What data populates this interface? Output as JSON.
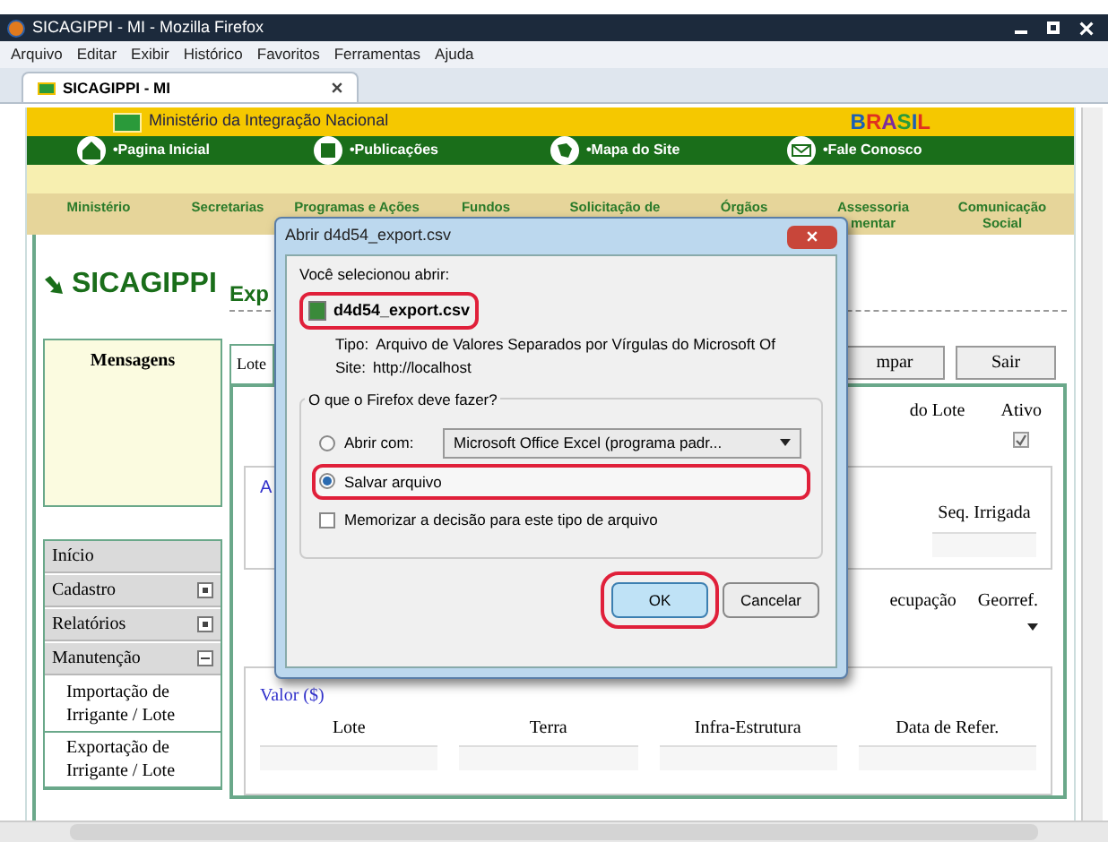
{
  "window": {
    "title": "SICAGIPPI - MI - Mozilla Firefox"
  },
  "menu": [
    "Arquivo",
    "Editar",
    "Exibir",
    "Histórico",
    "Favoritos",
    "Ferramentas",
    "Ajuda"
  ],
  "tabs": [
    {
      "label": "SICAGIPPI - MI",
      "selected": true
    }
  ],
  "site": {
    "ministry": "Ministério da Integração Nacional",
    "logo_letters": [
      "B",
      "R",
      "A",
      "S",
      "I",
      "L"
    ],
    "quick_links": [
      {
        "label": "•Pagina Inicial",
        "kind": "home"
      },
      {
        "label": "•Publicações",
        "kind": "book"
      },
      {
        "label": "•Mapa do Site",
        "kind": "map"
      },
      {
        "label": "•Fale Conosco",
        "kind": "mail"
      }
    ],
    "nav": [
      "Ministério",
      "Secretarias",
      "Programas e Ações",
      "Fundos",
      "Solicitação de",
      "Órgãos",
      "Assessoria\nmentar",
      "Comunicação\nSocial"
    ],
    "app_title": "SICAGIPPI"
  },
  "sidebar": {
    "messages_title": "Mensagens",
    "items": [
      {
        "label": "Início",
        "kind": "link"
      },
      {
        "label": "Cadastro",
        "kind": "group",
        "expanded": false
      },
      {
        "label": "Relatórios",
        "kind": "group",
        "expanded": false
      },
      {
        "label": "Manutenção",
        "kind": "group",
        "expanded": true,
        "children": [
          {
            "label": "Importação de Irrigante / Lote"
          },
          {
            "label": "Exportação de Irrigante / Lote"
          }
        ]
      }
    ]
  },
  "main": {
    "title": "Exp",
    "tab": "Lote",
    "buttons": [
      "mpar",
      "Sair"
    ],
    "lot_label": "do Lote",
    "active_label": "Ativo",
    "active_checked": true,
    "legend_fragment": "A",
    "seq_label": "Seq. Irrigada",
    "occupation_label": "ecupação",
    "georef_label": "Georref.",
    "values": {
      "legend": "Valor ($)",
      "columns": [
        "Lote",
        "Terra",
        "Infra-Estrutura",
        "Data de Refer."
      ]
    }
  },
  "dialog": {
    "title": "Abrir d4d54_export.csv",
    "intro": "Você selecionou abrir:",
    "file_name": "d4d54_export.csv",
    "type_label": "Tipo:",
    "type_value": "Arquivo de Valores Separados por Vírgulas do Microsoft Of",
    "site_label": "Site:",
    "site_value": "http://localhost",
    "group_title": "O que o Firefox deve fazer?",
    "options": [
      {
        "label": "Abrir com:",
        "selected": false
      },
      {
        "label": "Salvar arquivo",
        "selected": true
      }
    ],
    "app_choice": "Microsoft Office Excel (programa padr...",
    "remember": {
      "label": "Memorizar a decisão para este tipo de arquivo",
      "checked": false
    },
    "buttons": [
      {
        "label": "OK",
        "default": true
      },
      {
        "label": "Cancelar",
        "default": false
      }
    ]
  }
}
